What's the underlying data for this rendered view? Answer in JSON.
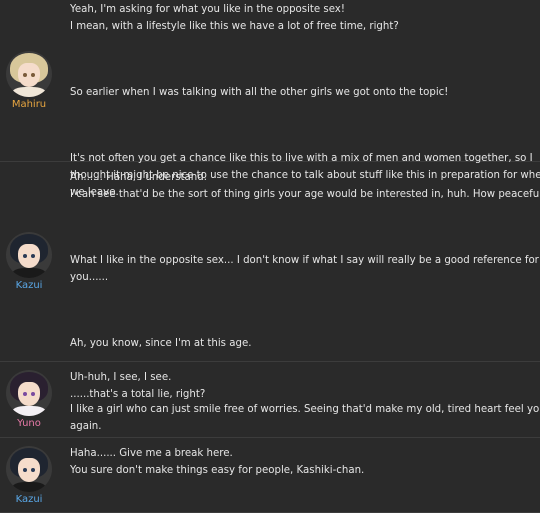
{
  "entries": [
    {
      "speaker": "Mahiru",
      "name_color": "#e8a640",
      "avatar_icon": "mahiru-portrait-icon",
      "lines": [
        "Yeah, I'm asking for what you like in the opposite sex!",
        "I mean, with a lifestyle like this we have a lot of free time, right?",
        "",
        "So earlier when I was talking with all the other girls we got onto the topic!",
        "",
        "It's not often you get a chance like this to live with a mix of men and women together, so I",
        "thought it might be nice to use the chance to talk about stuff like this in preparation for when",
        "we leave."
      ]
    },
    {
      "speaker": "Kazui",
      "name_color": "#5aa7e6",
      "avatar_icon": "kazui-portrait-icon",
      "lines": [
        "Ah...... Haha, I understand.",
        "I can see that'd be the sort of thing girls your age would be interested in, huh. How peaceful.",
        "",
        "What I like in the opposite sex... I don't know if what I say will really be a good reference for",
        "you......",
        "",
        "Ah, you know, since I'm at this age.",
        "",
        "I like a girl who can just smile free of worries. Seeing that'd make my old, tired heart feel young",
        "again."
      ]
    },
    {
      "speaker": "Yuno",
      "name_color": "#e87aa8",
      "avatar_icon": "yuno-portrait-icon",
      "lines": [
        "Uh-huh, I see, I see.",
        "......that's a total lie, right?"
      ]
    },
    {
      "speaker": "Kazui",
      "name_color": "#5aa7e6",
      "avatar_icon": "kazui-portrait-icon",
      "lines": [
        "Haha...... Give me a break here.",
        "You sure don't make things easy for people, Kashiki-chan."
      ]
    }
  ]
}
